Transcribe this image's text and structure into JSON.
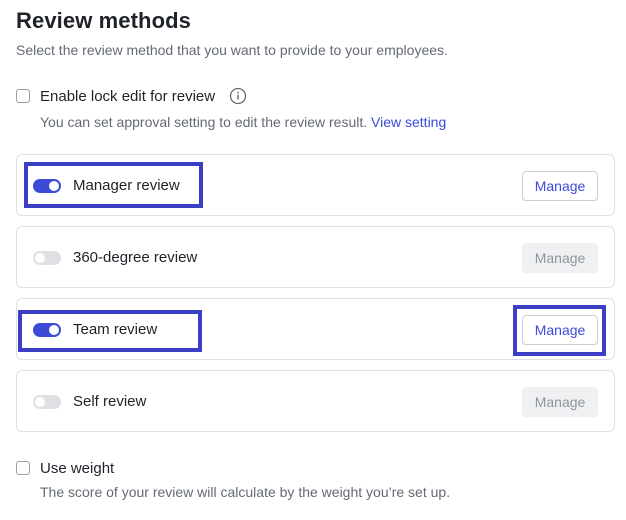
{
  "header": {
    "title": "Review methods",
    "subtitle": "Select the review method that you want to provide to your employees."
  },
  "lock_edit": {
    "label": "Enable lock edit for review",
    "checked": false,
    "info_icon": "info-icon",
    "hint": "You can set approval setting to edit the review result.",
    "link": "View setting"
  },
  "methods": [
    {
      "label": "Manager review",
      "enabled": true,
      "manage": "Manage",
      "manage_enabled": true
    },
    {
      "label": "360-degree review",
      "enabled": false,
      "manage": "Manage",
      "manage_enabled": false
    },
    {
      "label": "Team review",
      "enabled": true,
      "manage": "Manage",
      "manage_enabled": true
    },
    {
      "label": "Self review",
      "enabled": false,
      "manage": "Manage",
      "manage_enabled": false
    }
  ],
  "weight": {
    "label": "Use weight",
    "checked": false,
    "hint": "The score of your review will calculate by the weight you’re set up."
  },
  "colors": {
    "accent": "#3b4bd8",
    "highlight": "#3b3fc6",
    "toggle_off": "#dee0e3",
    "disabled_button": "#eff0f1"
  }
}
